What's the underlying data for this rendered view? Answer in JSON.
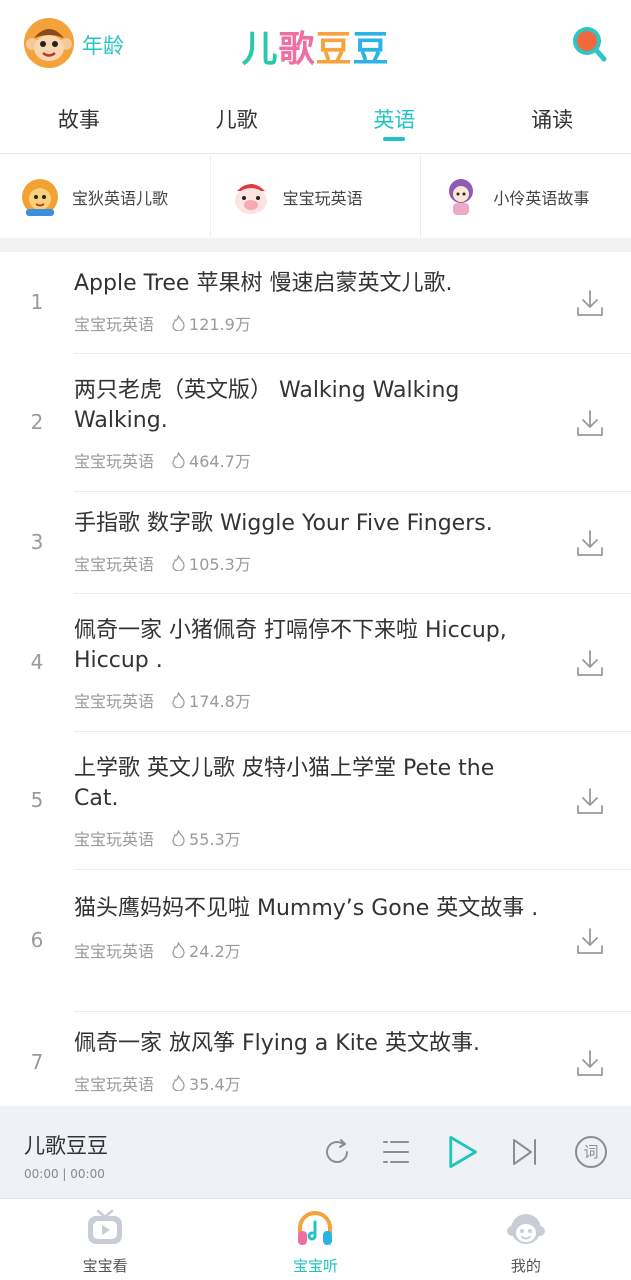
{
  "header": {
    "age_label": "年龄",
    "brand": [
      "儿",
      "歌",
      "豆",
      "豆"
    ],
    "avatar_icon": "monkey-avatar-icon",
    "search_icon": "search-icon"
  },
  "tabs": [
    {
      "label": "故事",
      "active": false
    },
    {
      "label": "儿歌",
      "active": false
    },
    {
      "label": "英语",
      "active": true
    },
    {
      "label": "诵读",
      "active": false
    }
  ],
  "channels": [
    {
      "label": "宝狄英语儿歌",
      "icon": "lion-mascot-icon"
    },
    {
      "label": "宝宝玩英语",
      "icon": "pig-mascot-icon"
    },
    {
      "label": "小伶英语故事",
      "icon": "girl-mascot-icon"
    }
  ],
  "songs": [
    {
      "num": "1",
      "title": "Apple Tree 苹果树 慢速启蒙英文儿歌.",
      "source": "宝宝玩英语",
      "plays": "121.9万"
    },
    {
      "num": "2",
      "title": "两只老虎（英文版） Walking Walking Walking.",
      "source": "宝宝玩英语",
      "plays": "464.7万"
    },
    {
      "num": "3",
      "title": "手指歌 数字歌 Wiggle Your Five Fingers.",
      "source": "宝宝玩英语",
      "plays": "105.3万"
    },
    {
      "num": "4",
      "title": "佩奇一家 小猪佩奇 打嗝停不下来啦 Hiccup, Hiccup .",
      "source": "宝宝玩英语",
      "plays": "174.8万"
    },
    {
      "num": "5",
      "title": "上学歌 英文儿歌 皮特小猫上学堂 Pete the Cat.",
      "source": "宝宝玩英语",
      "plays": "55.3万"
    },
    {
      "num": "6",
      "title": "猫头鹰妈妈不见啦 Mummy’s Gone 英文故事 .",
      "source": "宝宝玩英语",
      "plays": "24.2万"
    },
    {
      "num": "7",
      "title": "佩奇一家 放风筝 Flying a Kite  英文故事.",
      "source": "宝宝玩英语",
      "plays": "35.4万"
    }
  ],
  "player": {
    "title": "儿歌豆豆",
    "time": "00:00 | 00:00",
    "buttons": [
      "repeat-icon",
      "playlist-icon",
      "play-icon",
      "next-icon",
      "lyrics-icon"
    ],
    "lyrics_label": "词"
  },
  "bottom_nav": [
    {
      "label": "宝宝看",
      "icon": "tv-icon",
      "active": false
    },
    {
      "label": "宝宝听",
      "icon": "headphones-icon",
      "active": true
    },
    {
      "label": "我的",
      "icon": "monkey-face-icon",
      "active": false
    }
  ],
  "colors": {
    "accent": "#1fc3c3",
    "text": "#333333",
    "muted": "#9a9a9a",
    "player_bg": "#eef1f5"
  }
}
